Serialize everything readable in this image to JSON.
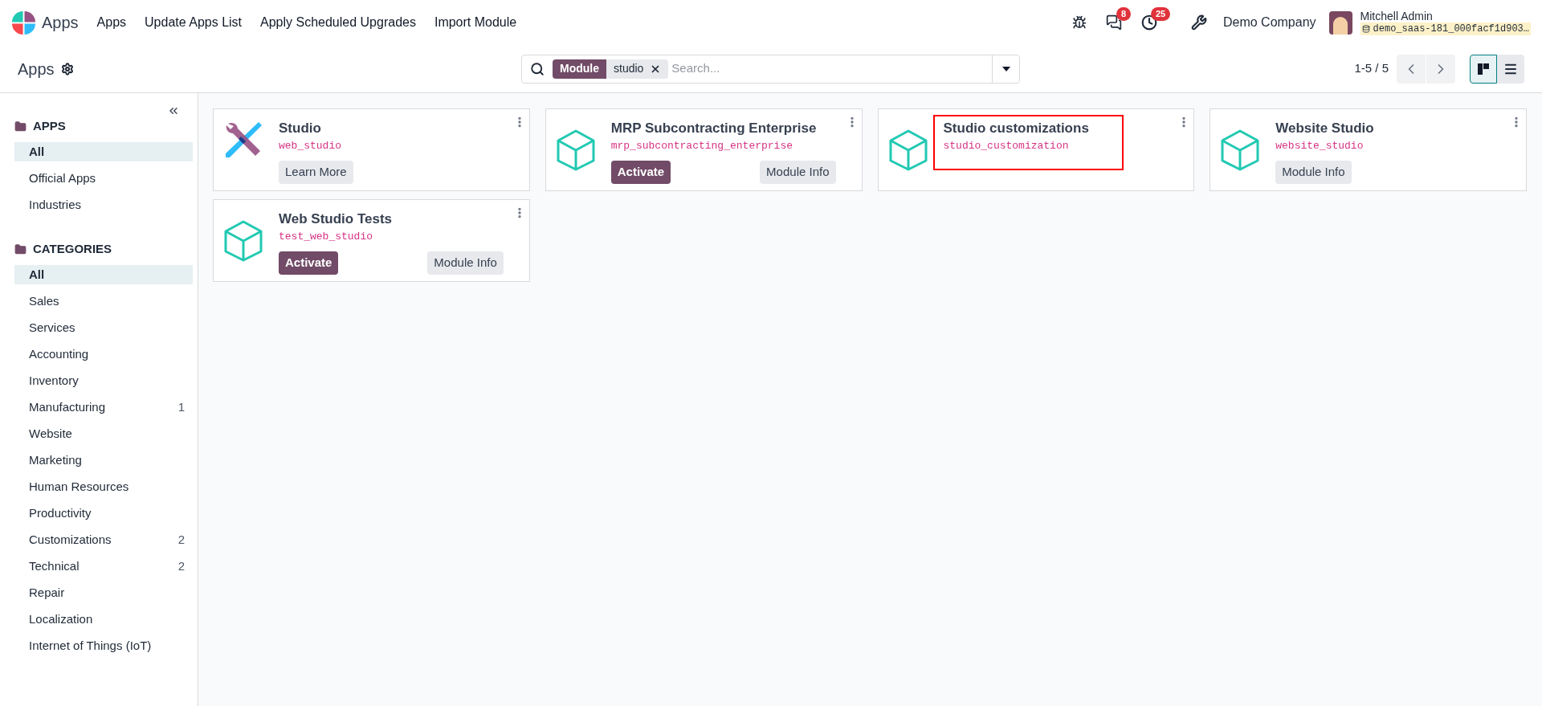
{
  "navbar": {
    "app_name": "Apps",
    "menu": [
      "Apps",
      "Update Apps List",
      "Apply Scheduled Upgrades",
      "Import Module"
    ],
    "messages_count": "8",
    "activities_count": "25",
    "company": "Demo Company",
    "user": {
      "name": "Mitchell Admin",
      "database": "demo_saas-181_000facf1d903…"
    }
  },
  "control_panel": {
    "title": "Apps",
    "search": {
      "facet_label": "Module",
      "facet_value": "studio",
      "placeholder": "Search..."
    },
    "pager": "1-5 / 5",
    "views": [
      {
        "kind": "kanban",
        "selected": true
      },
      {
        "kind": "list",
        "selected": false
      }
    ]
  },
  "sidebar": {
    "sections": [
      {
        "title": "APPS",
        "items": [
          {
            "label": "All",
            "selected": true
          },
          {
            "label": "Official Apps",
            "selected": false
          },
          {
            "label": "Industries",
            "selected": false
          }
        ]
      },
      {
        "title": "CATEGORIES",
        "items": [
          {
            "label": "All",
            "selected": true
          },
          {
            "label": "Sales",
            "selected": false
          },
          {
            "label": "Services",
            "selected": false
          },
          {
            "label": "Accounting",
            "selected": false
          },
          {
            "label": "Inventory",
            "selected": false
          },
          {
            "label": "Manufacturing",
            "count": "1",
            "selected": false
          },
          {
            "label": "Website",
            "selected": false
          },
          {
            "label": "Marketing",
            "selected": false
          },
          {
            "label": "Human Resources",
            "selected": false
          },
          {
            "label": "Productivity",
            "selected": false
          },
          {
            "label": "Customizations",
            "count": "2",
            "selected": false
          },
          {
            "label": "Technical",
            "count": "2",
            "selected": false
          },
          {
            "label": "Repair",
            "selected": false
          },
          {
            "label": "Localization",
            "selected": false
          },
          {
            "label": "Internet of Things (IoT)",
            "selected": false
          }
        ]
      }
    ]
  },
  "modules": [
    {
      "name": "Studio",
      "technical_name": "web_studio",
      "kind": "studio",
      "highlighted": false,
      "buttons": [
        {
          "label": "Learn More",
          "kind": "secondary"
        }
      ]
    },
    {
      "name": "MRP Subcontracting Enterprise",
      "technical_name": "mrp_subcontracting_enterprise",
      "kind": "cube",
      "highlighted": false,
      "buttons": [
        {
          "label": "Activate",
          "kind": "primary"
        },
        {
          "label": "Module Info",
          "kind": "secondary"
        }
      ]
    },
    {
      "name": "Studio customizations",
      "technical_name": "studio_customization",
      "kind": "cube",
      "highlighted": true
    },
    {
      "name": "Website Studio",
      "technical_name": "website_studio",
      "kind": "cube",
      "highlighted": false,
      "buttons": [
        {
          "label": "Module Info",
          "kind": "secondary"
        }
      ]
    },
    {
      "name": "Web Studio Tests",
      "technical_name": "test_web_studio",
      "kind": "cube",
      "highlighted": false,
      "buttons": [
        {
          "label": "Activate",
          "kind": "primary"
        },
        {
          "label": "Module Info",
          "kind": "secondary"
        }
      ]
    }
  ]
}
